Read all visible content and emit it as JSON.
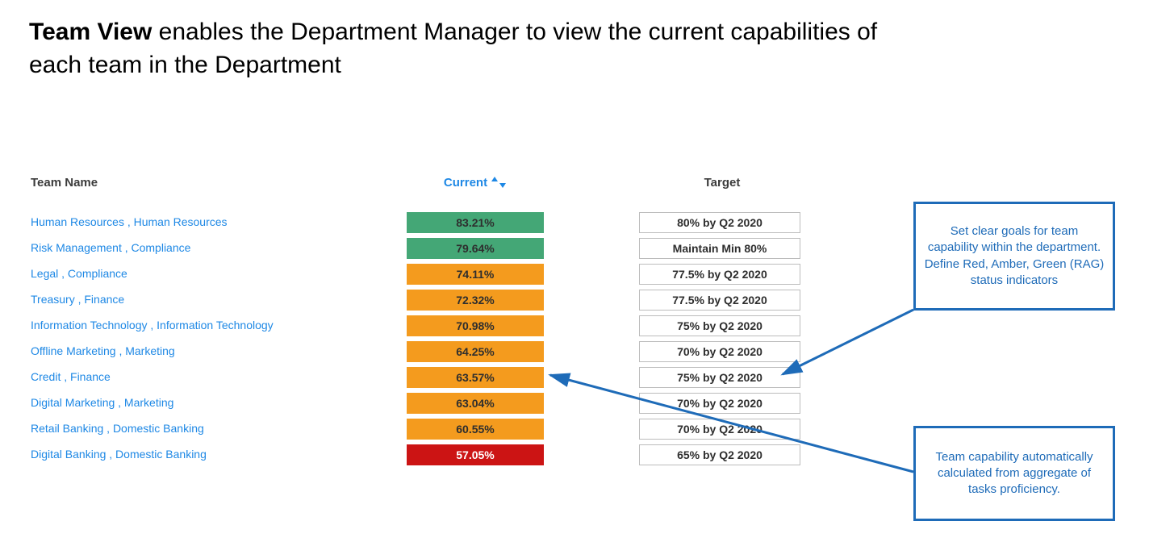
{
  "heading_bold": "Team View",
  "heading_rest": " enables the Department Manager to view the current capabilities of each team in the Department",
  "columns": {
    "name": "Team Name",
    "current": "Current",
    "target": "Target"
  },
  "rows": [
    {
      "team": "Human Resources , Human Resources",
      "pct": "83.21%",
      "status": "green",
      "target": "80% by Q2 2020"
    },
    {
      "team": "Risk Management , Compliance",
      "pct": "79.64%",
      "status": "green",
      "target": "Maintain Min 80%"
    },
    {
      "team": "Legal , Compliance",
      "pct": "74.11%",
      "status": "amber",
      "target": "77.5% by Q2 2020"
    },
    {
      "team": "Treasury , Finance",
      "pct": "72.32%",
      "status": "amber",
      "target": "77.5% by Q2 2020"
    },
    {
      "team": "Information Technology , Information Technology",
      "pct": "70.98%",
      "status": "amber",
      "target": "75% by Q2 2020"
    },
    {
      "team": "Offline Marketing , Marketing",
      "pct": "64.25%",
      "status": "amber",
      "target": "70% by Q2 2020"
    },
    {
      "team": "Credit , Finance",
      "pct": "63.57%",
      "status": "amber",
      "target": "75% by Q2 2020"
    },
    {
      "team": "Digital Marketing , Marketing",
      "pct": "63.04%",
      "status": "amber",
      "target": "70% by Q2 2020"
    },
    {
      "team": "Retail Banking , Domestic Banking",
      "pct": "60.55%",
      "status": "amber",
      "target": "70% by Q2 2020"
    },
    {
      "team": "Digital Banking , Domestic Banking",
      "pct": "57.05%",
      "status": "red",
      "target": "65% by Q2 2020"
    }
  ],
  "callouts": {
    "c1": "Set clear goals for team capability within the department. Define Red, Amber, Green (RAG) status indicators",
    "c2": "Team capability automatically calculated from aggregate of tasks proficiency."
  },
  "colors": {
    "blue": "#1e6bb8",
    "green": "#44a776",
    "amber": "#f49b1e",
    "red": "#cc1414"
  },
  "chart_data": {
    "type": "table",
    "columns": [
      "Team Name",
      "Current %",
      "RAG Status",
      "Target"
    ],
    "rows": [
      [
        "Human Resources , Human Resources",
        83.21,
        "green",
        "80% by Q2 2020"
      ],
      [
        "Risk Management , Compliance",
        79.64,
        "green",
        "Maintain Min 80%"
      ],
      [
        "Legal , Compliance",
        74.11,
        "amber",
        "77.5% by Q2 2020"
      ],
      [
        "Treasury , Finance",
        72.32,
        "amber",
        "77.5% by Q2 2020"
      ],
      [
        "Information Technology , Information Technology",
        70.98,
        "amber",
        "75% by Q2 2020"
      ],
      [
        "Offline Marketing , Marketing",
        64.25,
        "amber",
        "70% by Q2 2020"
      ],
      [
        "Credit , Finance",
        63.57,
        "amber",
        "75% by Q2 2020"
      ],
      [
        "Digital Marketing , Marketing",
        63.04,
        "amber",
        "70% by Q2 2020"
      ],
      [
        "Retail Banking , Domestic Banking",
        60.55,
        "amber",
        "70% by Q2 2020"
      ],
      [
        "Digital Banking , Domestic Banking",
        57.05,
        "red",
        "65% by Q2 2020"
      ]
    ]
  }
}
